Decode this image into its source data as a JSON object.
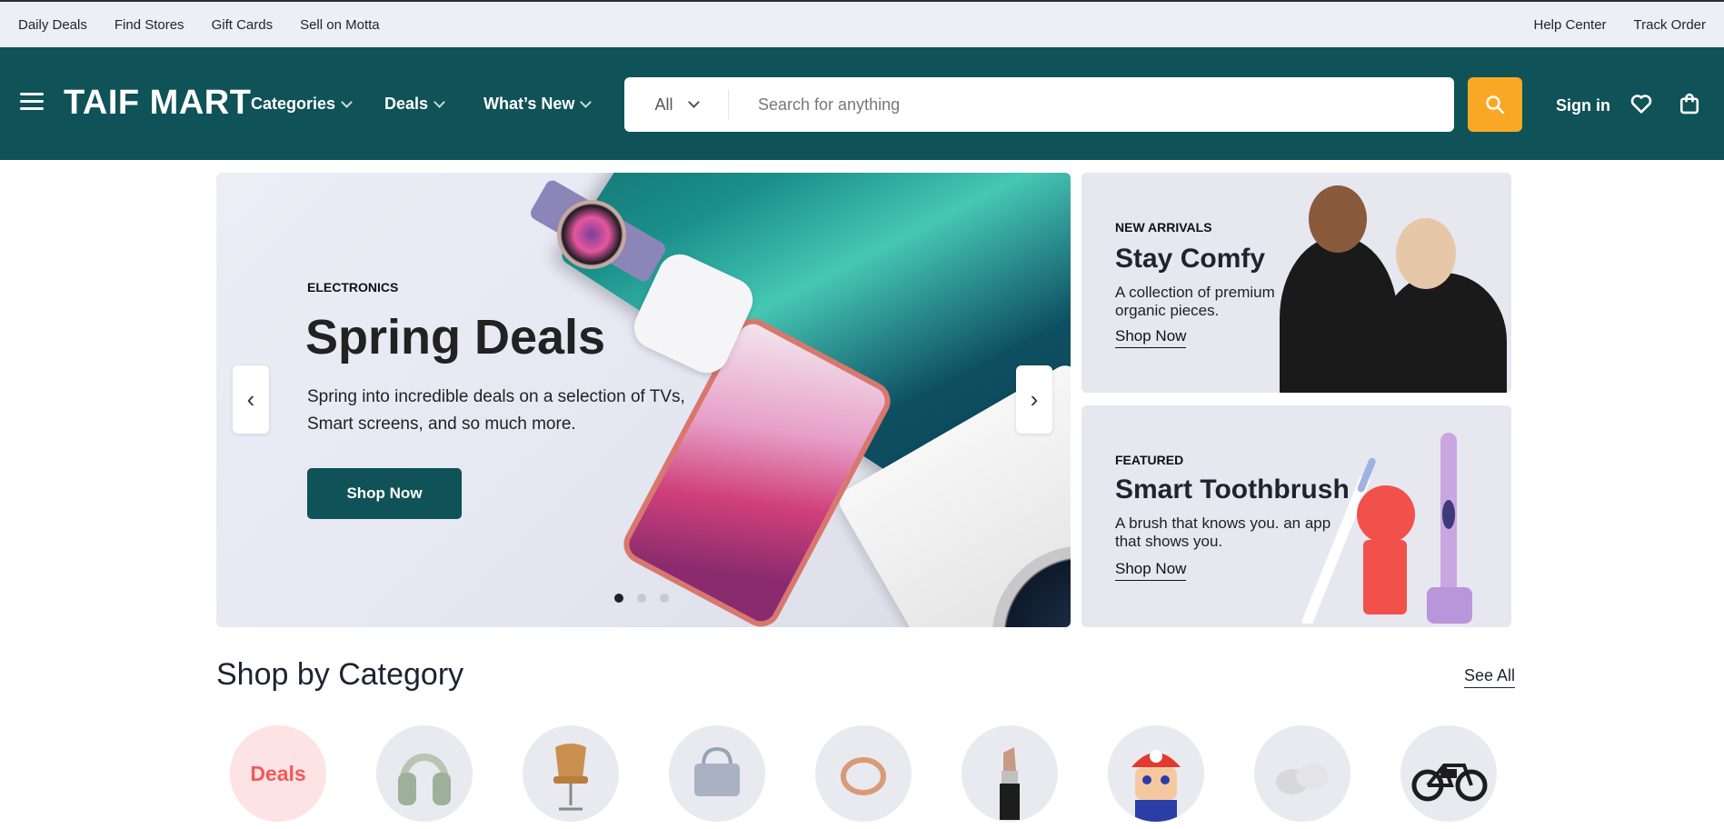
{
  "topbar": {
    "left_links": [
      "Daily Deals",
      "Find Stores",
      "Gift Cards",
      "Sell on Motta"
    ],
    "right_links": [
      "Help Center",
      "Track Order"
    ]
  },
  "header": {
    "logo": "TAIF MART",
    "nav": [
      {
        "label": "Categories"
      },
      {
        "label": "Deals"
      },
      {
        "label": "What’s New"
      }
    ],
    "search": {
      "category": "All",
      "placeholder": "Search for anything"
    },
    "signin": "Sign in",
    "icons": [
      "menu-icon",
      "search-icon",
      "heart-icon",
      "shopping-bag-icon"
    ]
  },
  "hero": {
    "kicker": "ELECTRONICS",
    "title": "Spring Deals",
    "description": "Spring into incredible deals on a selection of TVs, Smart screens, and so much more.",
    "cta": "Shop Now",
    "prev": "‹",
    "next": "›",
    "slides": 3,
    "active_slide": 1
  },
  "promos": [
    {
      "kicker": "NEW ARRIVALS",
      "title": "Stay Comfy",
      "description": "A collection of premium organic pieces.",
      "cta": "Shop Now"
    },
    {
      "kicker": "FEATURED",
      "title": "Smart Toothbrush",
      "description": "A brush that knows you. an app that shows you.",
      "cta": "Shop Now"
    }
  ],
  "categories_section": {
    "title": "Shop by Category",
    "see_all": "See All",
    "deals_label": "Deals",
    "items": [
      "deals",
      "headphones",
      "chair",
      "handbag",
      "ring",
      "lipstick",
      "toy-figure",
      "baby-shoes",
      "e-bike"
    ]
  },
  "colors": {
    "brand": "#0f5257",
    "accent": "#f9a825",
    "deals": "#ef5a5a"
  }
}
